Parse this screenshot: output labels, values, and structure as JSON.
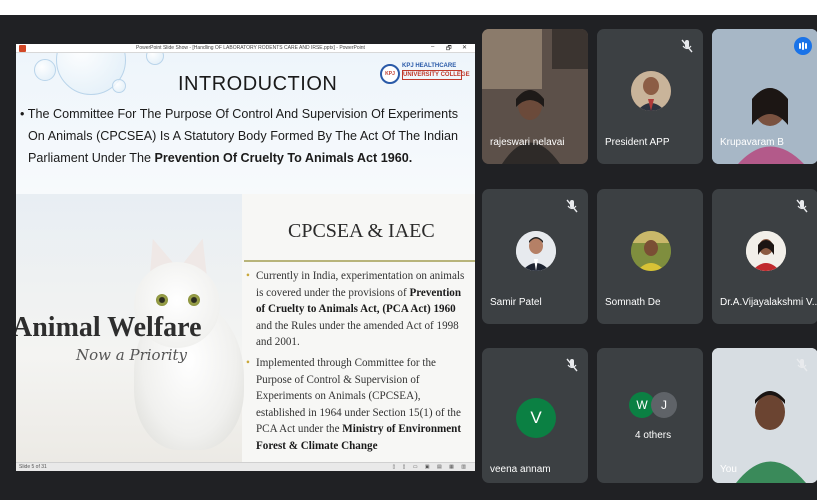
{
  "presentation": {
    "window_title": "PowerPoint Slide Show - [Handling OF LABORATORY RODENTS CARE AND IRSE.pptx] - PowerPoint",
    "window_controls": [
      "–",
      "🗗",
      "✕"
    ],
    "slide_indicator": "Slide 5 of 31",
    "college_logo": {
      "line1": "KPJ HEALTHCARE",
      "line2": "UNIVERSITY COLLEGE"
    },
    "intro": {
      "title": "INTRODUCTION",
      "text_part1": "The Committee For The Purpose Of Control And Supervision Of Experiments On Animals (CPCSEA) Is A Statutory Body Formed By The Act Of The Indian Parliament Under The ",
      "text_bold": "Prevention Of Cruelty To Animals Act 1960."
    },
    "welfare": {
      "title": "Animal Welfare",
      "subtitle": "Now a Priority"
    },
    "cpcsea": {
      "title": "CPCSEA & IAEC",
      "bullet1_part1": "Currently in India, experimentation on animals is covered under the provisions of ",
      "bullet1_bold1": "Prevention of Cruelty to Animals Act, (PCA Act) 1960",
      "bullet1_part2": " and the Rules under the amended Act of 1998 and 2001.",
      "bullet2_part1": "Implemented through Committee for the Purpose of Control & Supervision of Experiments on Animals (CPCSEA), established in 1964 under Section 15(1) of the PCA Act under the ",
      "bullet2_bold": "Ministry of Environment Forest & Climate Change"
    }
  },
  "participants": [
    {
      "name": "rajeswari nelavai",
      "muted": false,
      "icon": "camera-video"
    },
    {
      "name": "President APP",
      "muted": true,
      "icon": "mic-off-icon"
    },
    {
      "name": "Krupavaram B",
      "muted": false,
      "icon": "speaking-indicator-icon"
    },
    {
      "name": "Samir Patel",
      "muted": true,
      "icon": "mic-off-icon"
    },
    {
      "name": "Somnath De",
      "muted": false,
      "icon": "avatar"
    },
    {
      "name": "Dr.A.Vijayalakshmi V...",
      "muted": true,
      "icon": "mic-off-icon"
    },
    {
      "name": "veena annam",
      "muted": true,
      "initial": "V",
      "color": "#0b8043"
    },
    {
      "name": "4 others",
      "initials": [
        "W",
        "J"
      ],
      "colors": [
        "#0b8043",
        "#5f6368"
      ]
    },
    {
      "name": "You",
      "muted": true,
      "icon": "mic-off-icon"
    }
  ],
  "colors": {
    "background": "#202124",
    "tile": "#3c4043",
    "accent": "#1a73e8"
  }
}
